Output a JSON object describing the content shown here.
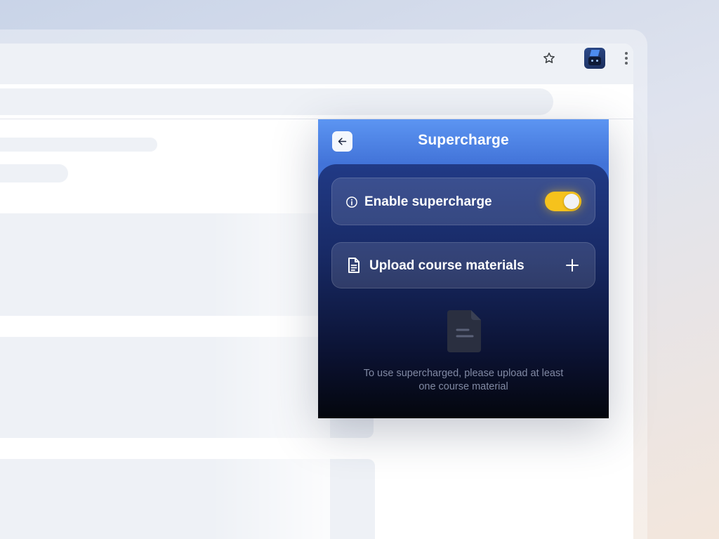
{
  "extension": {
    "title": "Supercharge",
    "enable_card": {
      "label": "Enable supercharge",
      "enabled": true
    },
    "upload_card": {
      "label": "Upload course materials"
    },
    "empty_state": {
      "message": "To use supercharged, please upload at least one course material"
    }
  },
  "colors": {
    "panel_header": "#5c95f2",
    "panel_body_top": "#213a86",
    "panel_body_bottom": "#04060d",
    "toggle_on": "#f6c21c",
    "empty_text": "#8089a3"
  },
  "icons": {
    "toolbar": [
      "star-icon",
      "extension-avatar-icon",
      "more-vert-icon"
    ],
    "panel": [
      "arrow-left-icon",
      "info-icon",
      "document-icon",
      "plus-icon",
      "document-placeholder-icon"
    ]
  }
}
